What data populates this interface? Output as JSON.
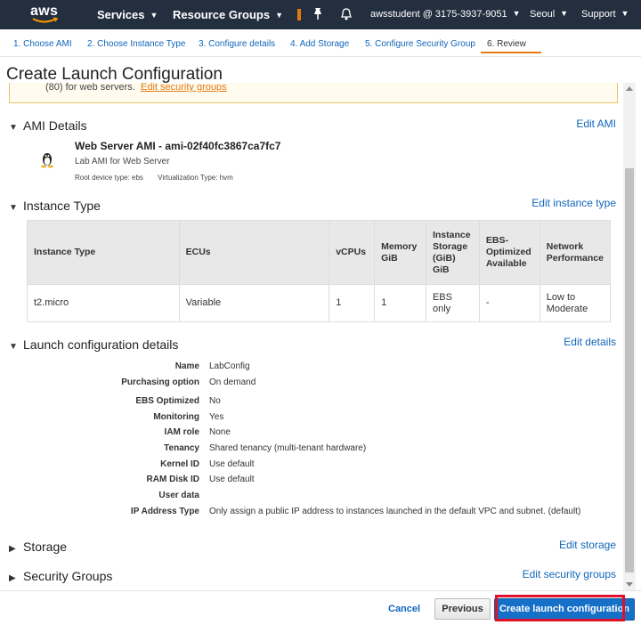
{
  "topnav": {
    "logo_text": "aws",
    "services": "Services",
    "resource_groups": "Resource Groups",
    "account": "awsstudent @ 3175-3937-9051",
    "region": "Seoul",
    "support": "Support"
  },
  "steps": [
    {
      "label": "1. Choose AMI"
    },
    {
      "label": "2. Choose Instance Type"
    },
    {
      "label": "3. Configure details"
    },
    {
      "label": "4. Add Storage"
    },
    {
      "label": "5. Configure Security Group"
    },
    {
      "label": "6. Review"
    }
  ],
  "page_title": "Create Launch Configuration",
  "warning": {
    "text": "(80) for web servers.",
    "link": "Edit security groups"
  },
  "ami": {
    "heading": "AMI Details",
    "edit": "Edit AMI",
    "title": "Web Server AMI - ami-02f40fc3867ca7fc7",
    "description": "Lab AMI for Web Server",
    "root_device": "Root device type: ebs",
    "virtualization": "Virtualization Type: hvm"
  },
  "instance_type": {
    "heading": "Instance Type",
    "edit": "Edit instance type",
    "columns": [
      "Instance Type",
      "ECUs",
      "vCPUs",
      "Memory GiB",
      "Instance Storage (GiB) GiB",
      "EBS-Optimized Available",
      "Network Performance"
    ],
    "row": [
      "t2.micro",
      "Variable",
      "1",
      "1",
      "EBS only",
      "-",
      "Low to Moderate"
    ]
  },
  "launch_details": {
    "heading": "Launch configuration details",
    "edit": "Edit details",
    "rows": [
      {
        "label": "Name",
        "value": "LabConfig"
      },
      {
        "label": "Purchasing option",
        "value": "On demand"
      },
      {
        "label": "EBS Optimized",
        "value": "No"
      },
      {
        "label": "Monitoring",
        "value": "Yes"
      },
      {
        "label": "IAM role",
        "value": "None"
      },
      {
        "label": "Tenancy",
        "value": "Shared tenancy (multi-tenant hardware)"
      },
      {
        "label": "Kernel ID",
        "value": "Use default"
      },
      {
        "label": "RAM Disk ID",
        "value": "Use default"
      },
      {
        "label": "User data",
        "value": ""
      },
      {
        "label": "IP Address Type",
        "value": "Only assign a public IP address to instances launched in the default VPC and subnet. (default)"
      }
    ]
  },
  "storage": {
    "heading": "Storage",
    "edit": "Edit storage"
  },
  "security_groups": {
    "heading": "Security Groups",
    "edit": "Edit security groups"
  },
  "footer": {
    "cancel": "Cancel",
    "previous": "Previous",
    "create": "Create launch configuration"
  },
  "colors": {
    "nav_bg": "#232f3e",
    "link": "#1166bb",
    "accent": "#e47911",
    "primary_button": "#1670c8",
    "highlight": "#e0102a"
  }
}
